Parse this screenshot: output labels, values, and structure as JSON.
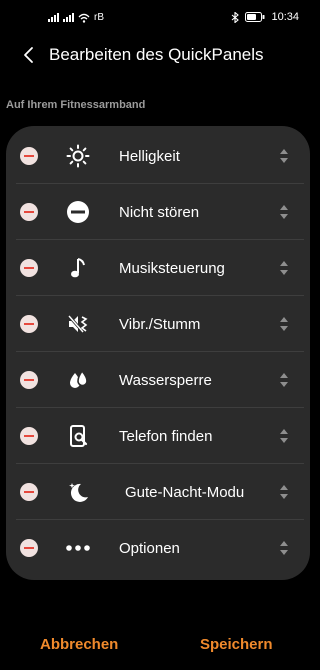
{
  "status_bar": {
    "carrier": "rB",
    "time": "10:34"
  },
  "header": {
    "title": "Bearbeiten des QuickPanels"
  },
  "section_title": "Auf Ihrem Fitnessarmband",
  "items": [
    {
      "label": "Helligkeit",
      "icon": "brightness-icon"
    },
    {
      "label": "Nicht stören",
      "icon": "do-not-disturb-icon"
    },
    {
      "label": "Musiksteuerung",
      "icon": "music-note-icon"
    },
    {
      "label": "Vibr./Stumm",
      "icon": "vibrate-mute-icon"
    },
    {
      "label": "Wassersperre",
      "icon": "water-lock-icon"
    },
    {
      "label": "Telefon finden",
      "icon": "find-phone-icon"
    },
    {
      "label": "Gute-Nacht-Modu",
      "icon": "moon-stars-icon"
    },
    {
      "label": "Optionen",
      "icon": "more-dots-icon"
    }
  ],
  "footer": {
    "cancel_label": "Abbrechen",
    "save_label": "Speichern"
  },
  "colors": {
    "accent": "#f08a2c",
    "remove": "#e6483d",
    "card": "#2b2b2b"
  }
}
